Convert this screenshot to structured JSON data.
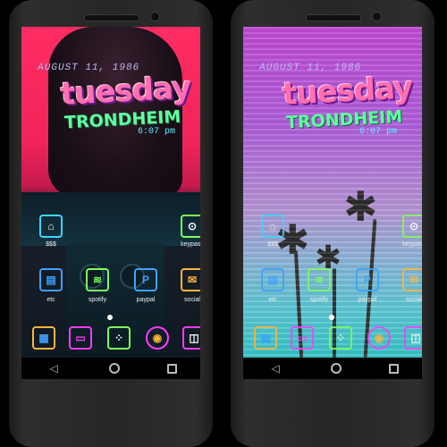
{
  "widget": {
    "date": "AUGUST 11, 1986",
    "day": "tuesday",
    "city": "TRONDHEIM",
    "time": "6:07 pm"
  },
  "apps": {
    "home_label": "$$$",
    "keypass_label": "keypass",
    "etc_label": "etc",
    "spotify_label": "spotify",
    "paypal_label": "paypal",
    "social_label": "social"
  },
  "icons": {
    "home": "house-icon",
    "keypass": "keyhole-icon",
    "etc": "document-icon",
    "spotify": "spotify-icon",
    "paypal": "paypal-icon",
    "social": "envelope-icon",
    "dock": [
      "calculator-icon",
      "chat-icon",
      "app-drawer-icon",
      "chrome-icon",
      "camera-icon"
    ]
  },
  "colors": {
    "cyan": "#3ad7ff",
    "green": "#7dff5a",
    "blue": "#3aa2ff",
    "orange": "#ffb43a",
    "magenta": "#ff3aff",
    "pink": "#ff6fb0"
  }
}
